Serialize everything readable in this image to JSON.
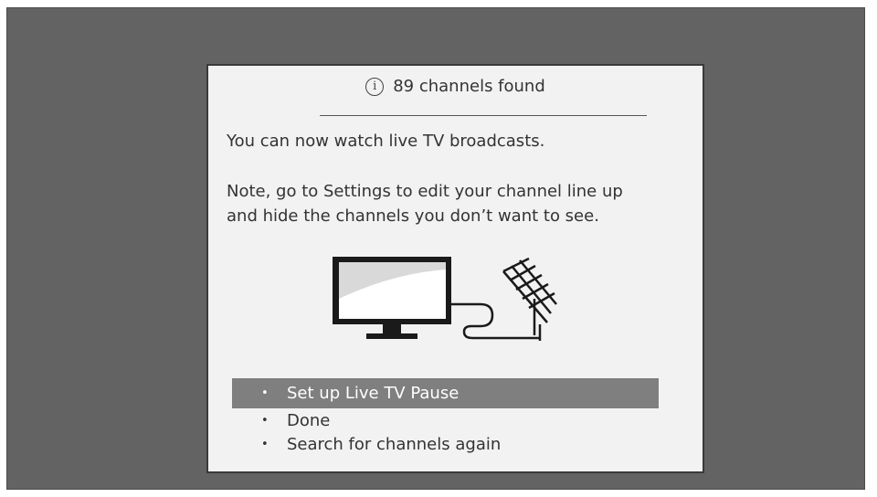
{
  "dialog": {
    "header_icon": "info-icon",
    "header_icon_glyph": "i",
    "header_title": "89 channels found",
    "message": "You can now watch live TV broadcasts.",
    "note_line1": "Note, go to Settings to edit your channel line up",
    "note_line2": "and hide the channels you don’t want to see.",
    "illustration_icons": [
      "tv-icon",
      "antenna-icon"
    ]
  },
  "menu": {
    "bullet": "•",
    "items": [
      {
        "label": "Set up Live TV Pause",
        "selected": true
      },
      {
        "label": "Done",
        "selected": false
      },
      {
        "label": "Search for channels again",
        "selected": false
      }
    ]
  },
  "colors": {
    "background": "#636363",
    "dialog": "#f2f2f2",
    "selection": "#7f7f7f"
  }
}
